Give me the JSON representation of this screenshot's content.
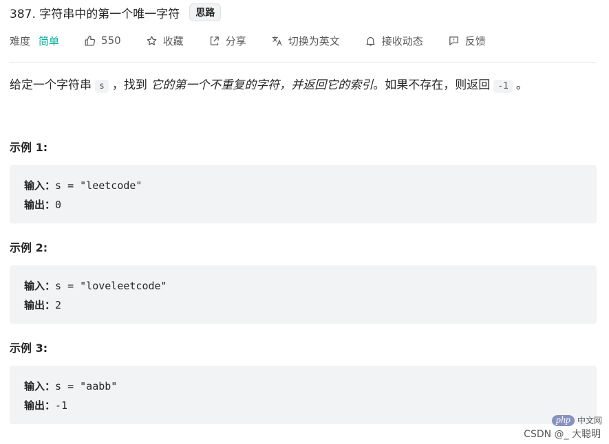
{
  "problem": {
    "title": "387. 字符串中的第一个唯一字符",
    "hint_tag": "思路"
  },
  "meta": {
    "difficulty_label": "难度",
    "difficulty_value": "简单",
    "likes": "550",
    "favorite": "收藏",
    "share": "分享",
    "switch_lang": "切换为英文",
    "subscribe": "接收动态",
    "feedback": "反馈",
    "difficulty_color": "#00af9b"
  },
  "description": {
    "part1": "给定一个字符串",
    "code_s": "s",
    "part2": "，找到",
    "emph": "它的第一个不重复的字符，并返回它的索引",
    "part3": "。如果不存在，则返回",
    "code_neg": "-1",
    "part4": "。"
  },
  "examples": [
    {
      "title": "示例 1:",
      "input_label": "输入：",
      "input": "s = \"leetcode\"",
      "output_label": "输出：",
      "output": "0"
    },
    {
      "title": "示例 2:",
      "input_label": "输入：",
      "input": "s = \"loveleetcode\"",
      "output_label": "输出：",
      "output": "2"
    },
    {
      "title": "示例 3:",
      "input_label": "输入：",
      "input": "s = \"aabb\"",
      "output_label": "输出：",
      "output": "-1"
    }
  ],
  "watermark": {
    "php": "php",
    "cn": "中文网",
    "csdn": "CSDN @_ 大聪明"
  }
}
